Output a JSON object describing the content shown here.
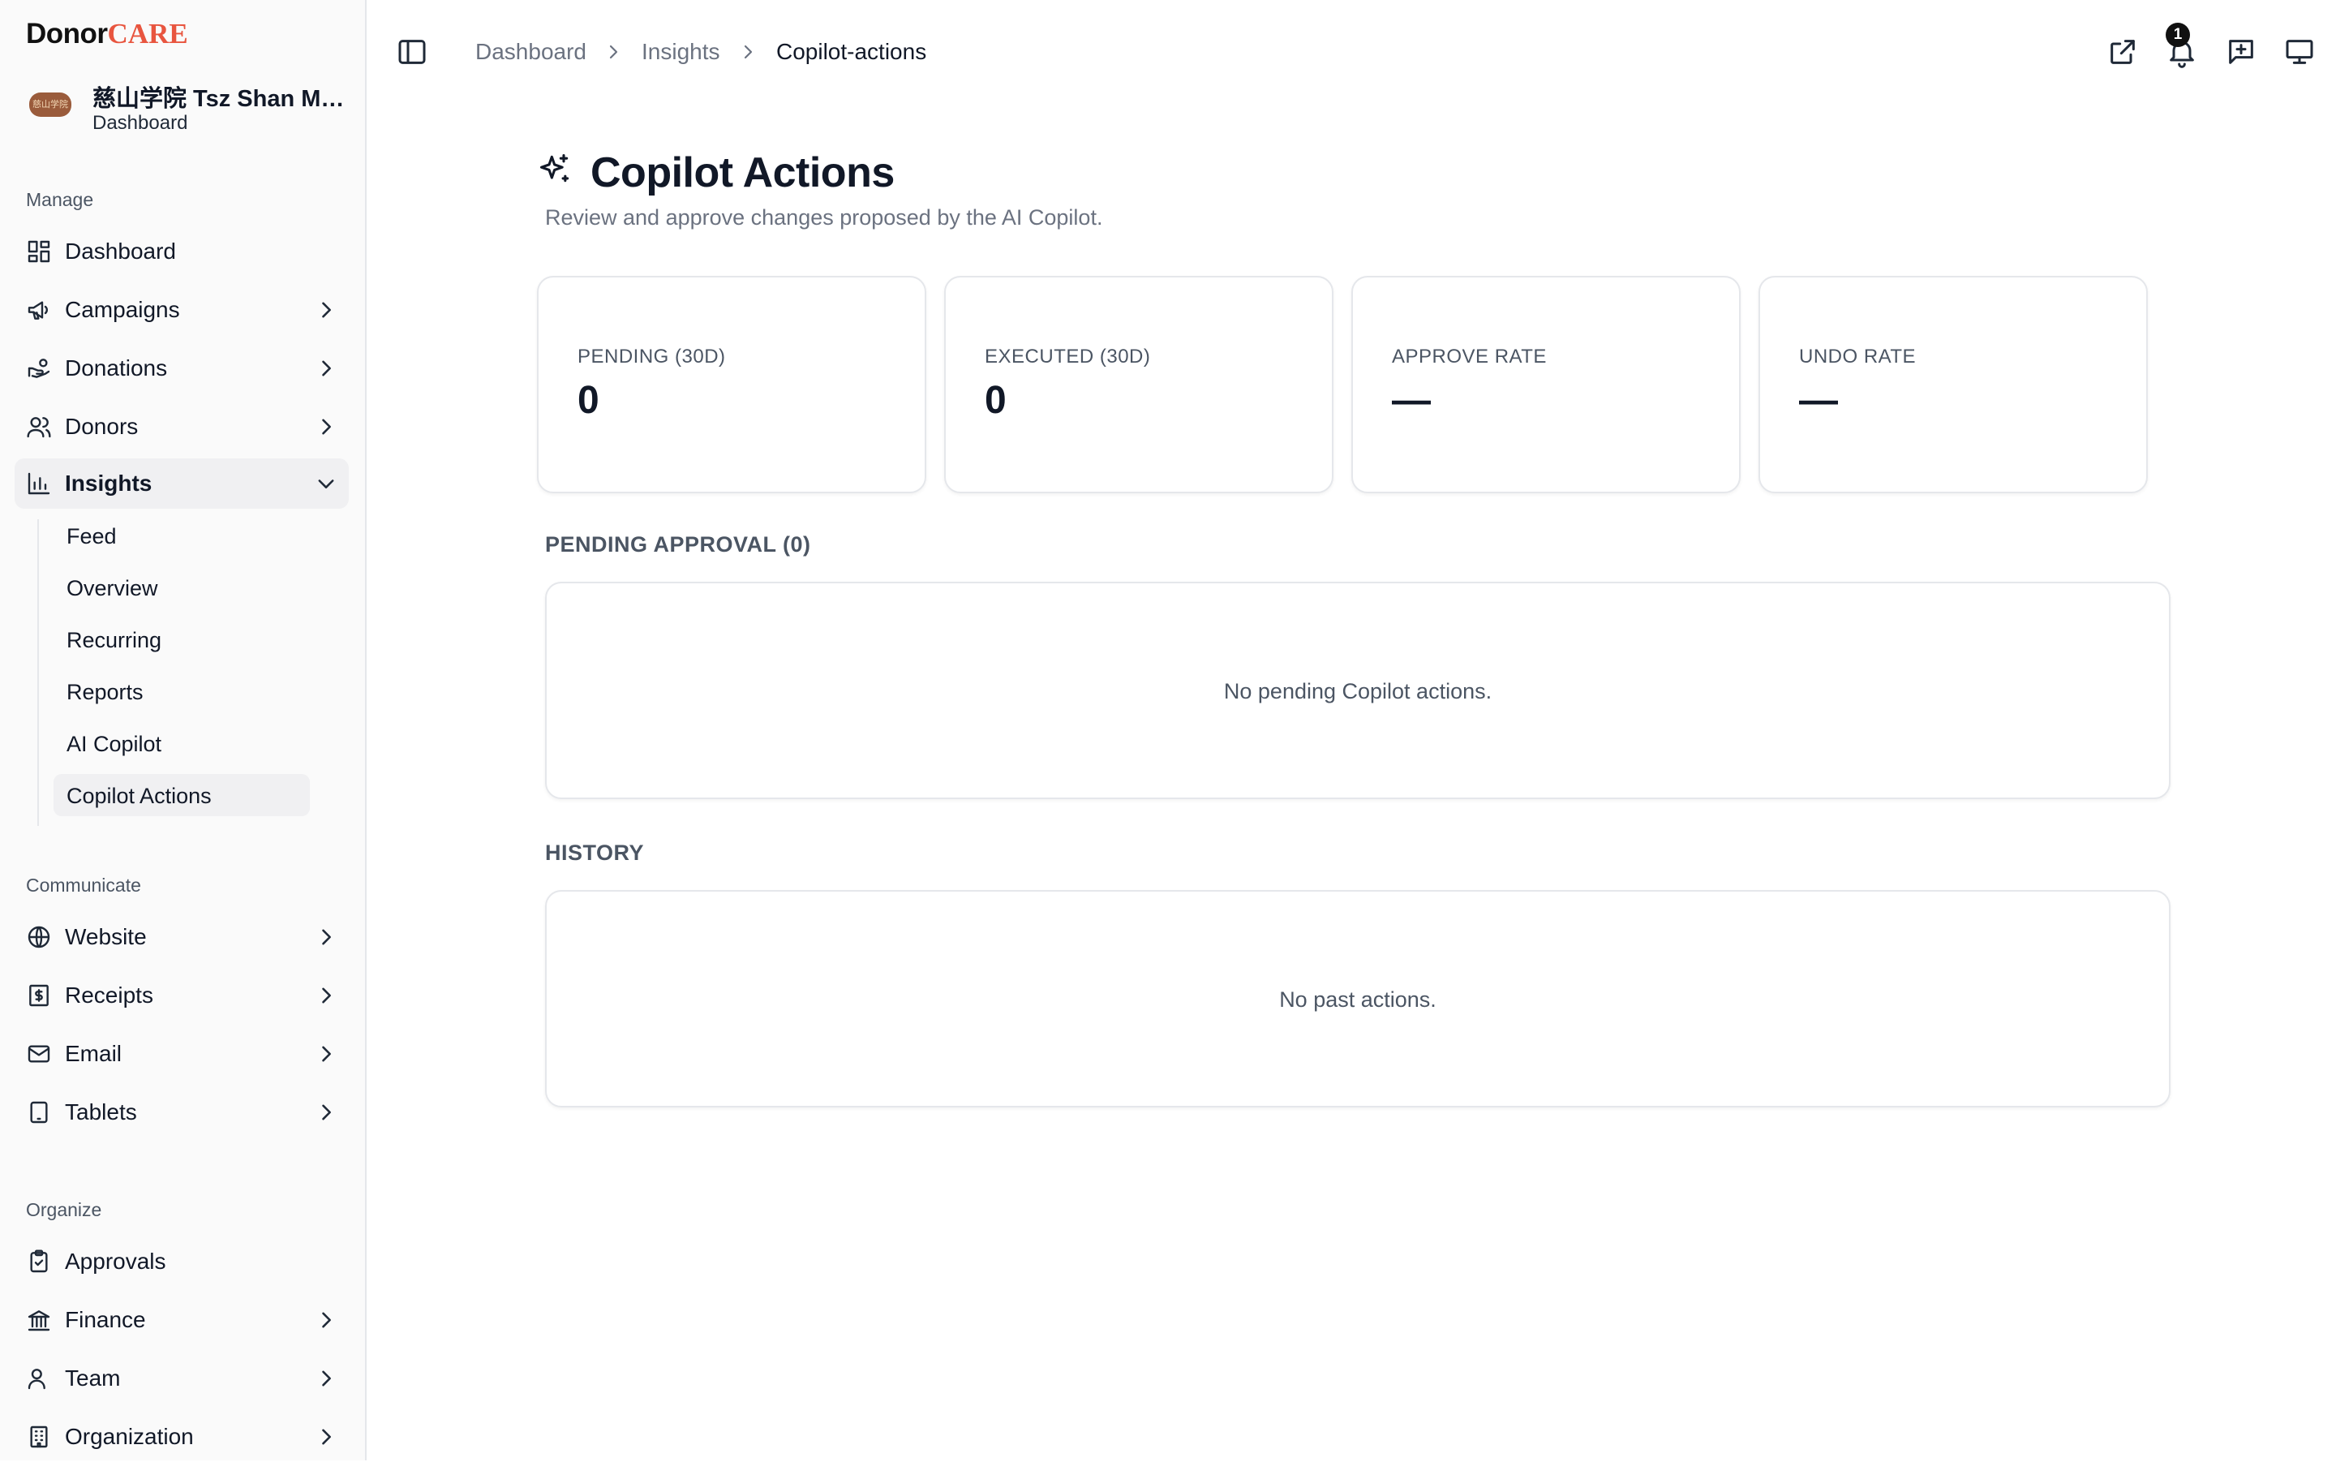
{
  "brand": {
    "part1": "Donor",
    "part2": "CARE",
    "accent": "#e8553f"
  },
  "org": {
    "name": "慈山学院 Tsz Shan Mo...",
    "subtitle": "Dashboard",
    "logo_text": "慈山学院"
  },
  "sidebar": {
    "manage_label": "Manage",
    "manage": [
      {
        "label": "Dashboard",
        "icon": "dashboard-icon",
        "chevron": false
      },
      {
        "label": "Campaigns",
        "icon": "megaphone-icon",
        "chevron": true
      },
      {
        "label": "Donations",
        "icon": "hand-coins-icon",
        "chevron": true
      },
      {
        "label": "Donors",
        "icon": "users-icon",
        "chevron": true
      },
      {
        "label": "Insights",
        "icon": "bar-chart-icon",
        "chevron": true,
        "expanded": true
      }
    ],
    "insights_sub": [
      "Feed",
      "Overview",
      "Recurring",
      "Reports",
      "AI Copilot",
      "Copilot Actions"
    ],
    "communicate_label": "Communicate",
    "communicate": [
      {
        "label": "Website",
        "icon": "globe-icon"
      },
      {
        "label": "Receipts",
        "icon": "receipt-icon"
      },
      {
        "label": "Email",
        "icon": "mail-icon"
      },
      {
        "label": "Tablets",
        "icon": "tablet-icon"
      }
    ],
    "organize_label": "Organize",
    "organize": [
      {
        "label": "Approvals",
        "icon": "clipboard-check-icon",
        "chevron": false
      },
      {
        "label": "Finance",
        "icon": "bank-icon",
        "chevron": true
      },
      {
        "label": "Team",
        "icon": "user-icon",
        "chevron": true
      },
      {
        "label": "Organization",
        "icon": "building-icon",
        "chevron": true
      }
    ]
  },
  "header": {
    "breadcrumbs": [
      "Dashboard",
      "Insights",
      "Copilot-actions"
    ],
    "notification_count": "1"
  },
  "main": {
    "title": "Copilot Actions",
    "subtitle": "Review and approve changes proposed by the AI Copilot.",
    "stats": [
      {
        "label": "PENDING (30D)",
        "value": "0"
      },
      {
        "label": "EXECUTED (30D)",
        "value": "0"
      },
      {
        "label": "APPROVE RATE",
        "value": "—"
      },
      {
        "label": "UNDO RATE",
        "value": "—"
      }
    ],
    "pending_title": "PENDING APPROVAL (0)",
    "pending_empty": "No pending Copilot actions.",
    "history_title": "HISTORY",
    "history_empty": "No past actions."
  }
}
